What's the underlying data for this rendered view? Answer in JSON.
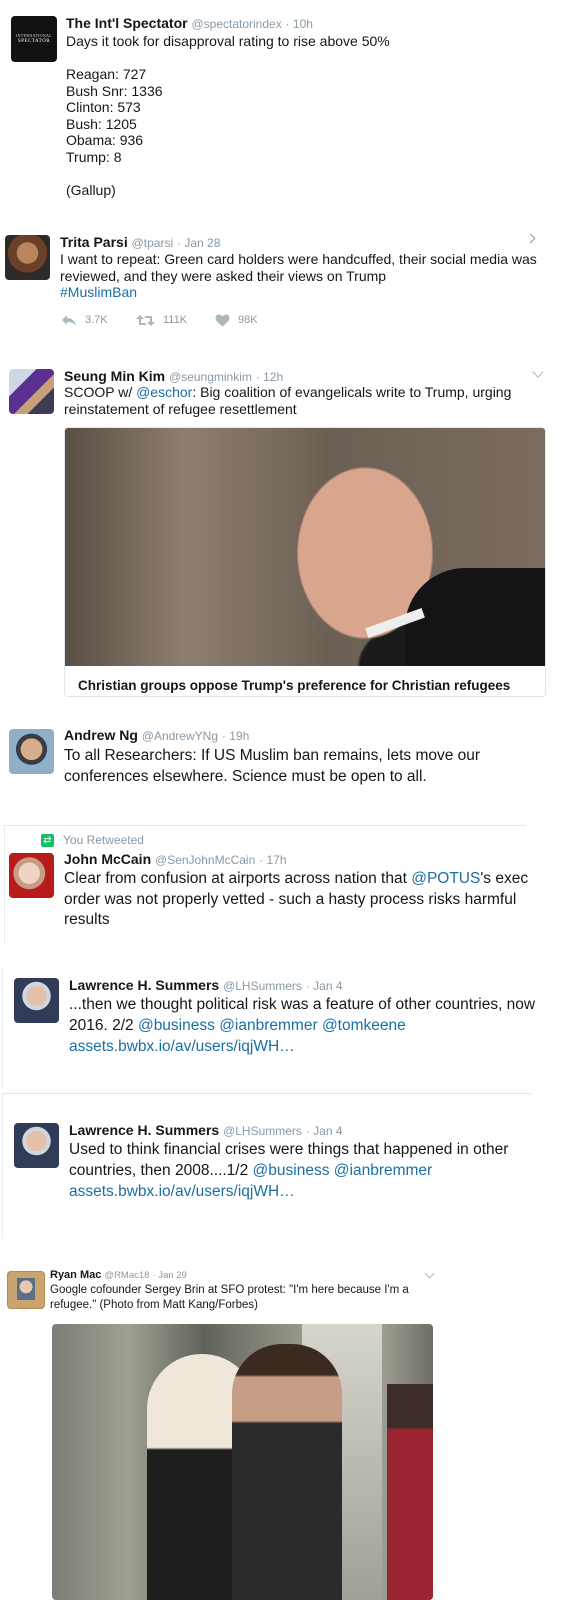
{
  "tweets": [
    {
      "name": "The Int'l Spectator",
      "handle": "@spectatorindex",
      "time": "· 10h",
      "avatar_text_1": "INTERNATIONAL",
      "avatar_text_2": "SPECTATOR",
      "lines": [
        "Days it took for disapproval rating to rise above 50%",
        "",
        "Reagan: 727",
        "Bush Snr: 1336",
        "Clinton: 573",
        "Bush: 1205",
        "Obama: 936",
        "Trump: 8",
        "",
        "(Gallup)"
      ]
    },
    {
      "name": "Trita Parsi",
      "handle": "@tparsi",
      "time": "· Jan 28",
      "text": "I want to repeat: Green card holders were handcuffed, their social media was reviewed, and they were asked their views on Trump",
      "hashtag": "#MuslimBan",
      "replies": "3.7K",
      "retweets": "111K",
      "likes": "98K"
    },
    {
      "name": "Seung Min Kim",
      "handle": "@seungminkim",
      "time": "· 12h",
      "text_prefix": "SCOOP w/ ",
      "mention": "@eschor",
      "text_suffix": ": Big coalition of evangelicals write to Trump, urging reinstatement of refugee resettlement",
      "card_title": "Christian groups oppose Trump's preference for Christian refugees"
    },
    {
      "name": "Andrew Ng",
      "handle": "@AndrewYNg",
      "time": "· 19h",
      "text": "To all Researchers: If US Muslim ban remains, lets move our conferences elsewhere. Science must be open to all."
    },
    {
      "retweet_label": "You Retweeted",
      "name": "John McCain",
      "handle": "@SenJohnMcCain",
      "time": "· 17h",
      "text_prefix": "Clear from confusion at airports across nation that ",
      "mention": "@POTUS",
      "text_suffix": "'s exec order was not properly vetted - such a hasty process risks harmful results"
    },
    {
      "name": "Lawrence H. Summers",
      "handle": "@LHSummers",
      "time": "· Jan 4",
      "text": "...then we thought political risk was a feature of other countries, now 2016.  2/2 ",
      "mentions": [
        "@business",
        "@ianbremmer",
        "@tomkeene"
      ],
      "url": "assets.bwbx.io/av/users/iqjWH…"
    },
    {
      "name": "Lawrence H. Summers",
      "handle": "@LHSummers",
      "time": "· Jan 4",
      "text": "Used to think financial crises were things that happened in other countries, then 2008....1/2 ",
      "mentions": [
        "@business",
        "@ianbremmer"
      ],
      "url": "assets.bwbx.io/av/users/iqjWH…"
    },
    {
      "name": "Ryan Mac",
      "handle": "@RMac18",
      "time": "· Jan 29",
      "text": "Google cofounder Sergey Brin at SFO protest: \"I'm here because I'm a refugee.\" (Photo from Matt Kang/Forbes)"
    }
  ],
  "colors": {
    "link": "#1b6fa3",
    "meta": "#8899a6",
    "retweet_green": "#17bf63"
  }
}
